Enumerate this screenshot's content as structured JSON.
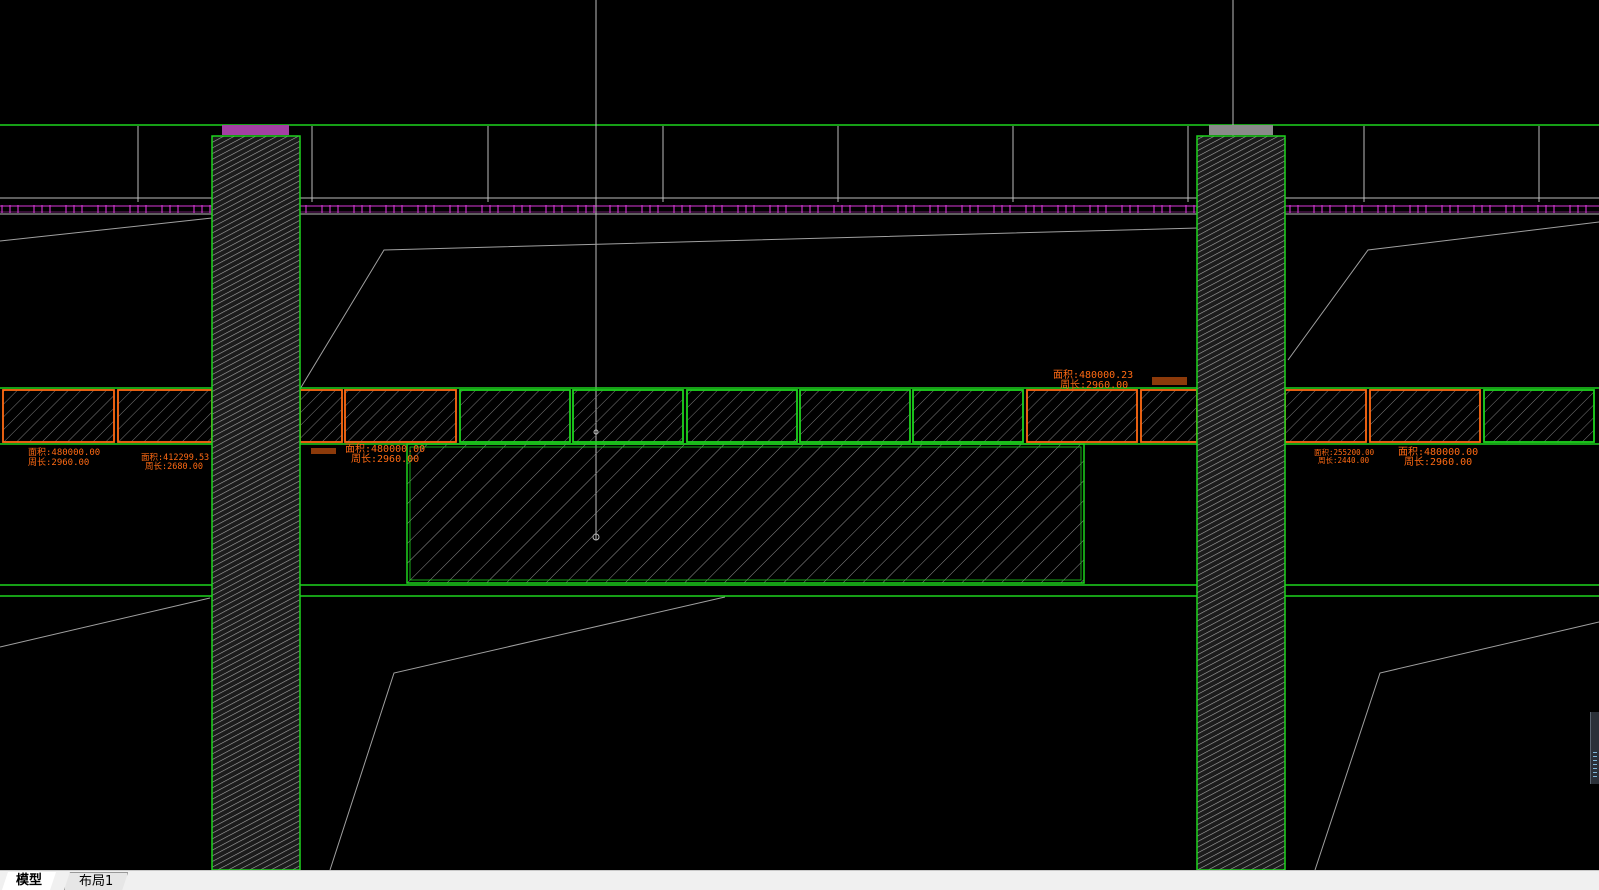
{
  "app": {
    "name": "CAD drawing viewport"
  },
  "tabs": [
    {
      "label": "模型",
      "active": true
    },
    {
      "label": "布局1",
      "active": false
    }
  ],
  "colors": {
    "background": "#000000",
    "outline_green": "#1ed41e",
    "annotation_orange": "#ff6a13",
    "magenta_strip": "#d838d8",
    "guide_gray": "#8a8a8a",
    "column_hatch": "#9a9a9a"
  },
  "annotations": [
    {
      "id": "a1",
      "area": "面积:480000.00",
      "perim": "周长:2960.00"
    },
    {
      "id": "a2",
      "area": "面积:412299.53",
      "perim": "周长:2680.00"
    },
    {
      "id": "a3",
      "area": "面积:480000.00",
      "perim": "周长:2960.00"
    },
    {
      "id": "a4",
      "area": "面积:480000.23",
      "perim": "周长:2960.00"
    },
    {
      "id": "a5",
      "area": "面积:255200.00",
      "perim": "周长:2440.00"
    },
    {
      "id": "a6",
      "area": "面积:480000.00",
      "perim": "周长:2960.00"
    }
  ]
}
